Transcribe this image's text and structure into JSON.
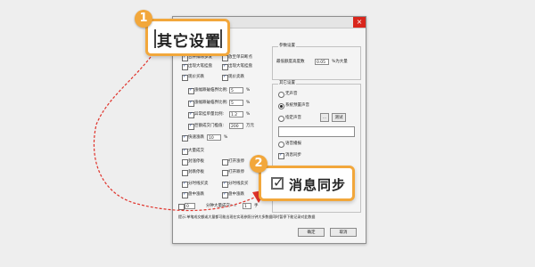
{
  "callouts": {
    "one": {
      "number": "1",
      "label": "其它设置"
    },
    "two": {
      "number": "2",
      "label": "消息同步"
    }
  },
  "colors": {
    "accent": "#f2a73b",
    "arrow": "#e0322a",
    "close": "#d9261c"
  },
  "left_panel": {
    "top_options": [
      {
        "label": "合并排除多发",
        "checked": true
      },
      {
        "label": "放至单日断点",
        "checked": false
      }
    ],
    "row2": [
      {
        "label": "出现大笔挂盘",
        "checked": true
      },
      {
        "label": "出现大笔挂盘",
        "checked": true
      }
    ],
    "row3": [
      {
        "label": "现价买跌",
        "checked": true
      },
      {
        "label": "现价卖跌",
        "checked": true
      }
    ],
    "params": [
      {
        "label": "涨幅跌破临界比例:",
        "value": "5",
        "unit": "%"
      },
      {
        "label": "涨幅跌破临界比例:",
        "value": "5",
        "unit": "%"
      },
      {
        "label": "异常挂单量比例:",
        "value": "1.2",
        "unit": "%"
      },
      {
        "label": "巨额成交门槛值:",
        "value": "200",
        "unit": "万元"
      }
    ],
    "param_checks": [
      true,
      true,
      true,
      true
    ],
    "speed": {
      "label": "快速涨跌",
      "value": "10",
      "unit": "%",
      "checked": true
    },
    "big_trade": {
      "label": "大量成交",
      "checked": true
    },
    "grid_rows": [
      [
        {
          "label": "封涨停板",
          "checked": false
        },
        {
          "label": "打开涨停",
          "checked": false
        }
      ],
      [
        {
          "label": "封跌停板",
          "checked": false
        },
        {
          "label": "打开跌停",
          "checked": false
        }
      ],
      [
        {
          "label": "分时线买卖",
          "checked": true
        },
        {
          "label": "分时线卖买",
          "checked": true
        }
      ],
      [
        {
          "label": "盘中涨跌",
          "checked": true
        },
        {
          "label": "盘中涨跌",
          "checked": true
        }
      ]
    ],
    "bottom_row": {
      "value": "0",
      "label": "分钟大量成交>=",
      "value2": "1",
      "unit": "手"
    }
  },
  "right_panel": {
    "params_group": "参数设置",
    "threshold_label": "最低额度高度数",
    "threshold_value": "0.05",
    "threshold_unit": "%为大量",
    "other_group": "其它设置",
    "radios": [
      {
        "label": "无声音",
        "selected": false
      },
      {
        "label": "系统预置声音",
        "selected": true
      },
      {
        "label": "指定声音",
        "selected": false
      }
    ],
    "browse_button": "...",
    "test_button": "测试",
    "radio4": {
      "label": "语音播报",
      "selected": false
    },
    "sync_check": {
      "label": "消息同步",
      "checked": true
    }
  },
  "footer": {
    "hint": "提示:单笔成交额或大量都可能出现在实现参照分钟大多数据同时暂停下能记录对此数据",
    "ok": "确定",
    "cancel": "取消"
  }
}
